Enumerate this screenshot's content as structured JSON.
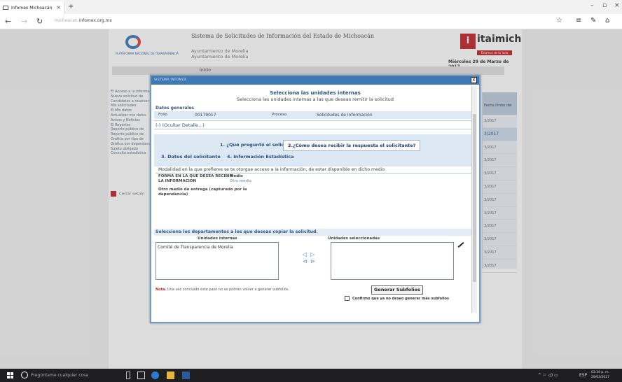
{
  "browser": {
    "tab_title": "Infomex Michoacán",
    "tab_close": "×",
    "new_tab": "+",
    "nav": {
      "back": "←",
      "forward": "→",
      "refresh": "↻"
    },
    "url_prefix": "michoacan.",
    "url": "infomex.org.mx",
    "window": {
      "minimize": "–",
      "restore": "▫",
      "close": "×"
    },
    "tools": {
      "favorite": "☆",
      "hub": "≡",
      "notes": "✎",
      "share": "⌂"
    }
  },
  "site": {
    "logo_caption": "PLATAFORMA NACIONAL DE TRANSPARENCIA",
    "title": "Sistema de Solicitudes de Información del Estado de Michoacán",
    "sub1": "Ayuntamiento de Morelia",
    "sub2": "Ayuntamiento de Morelia",
    "brand": "itaimich",
    "brand_mark": "i",
    "brand_pill": "Estamos de tu lado",
    "date": "Miércoles 29 de Marzo de 2017",
    "menu_home": "Inicio",
    "sidebar": [
      "El Acceso a la información",
      "Nueva solicitud de",
      "Candidatos a resolver",
      "Mis solicitudes",
      "El Mis datos",
      "Actualizar mis datos",
      "Avisos y Noticias",
      "El Reportes",
      "Reporte público de",
      "Reporte público de",
      "Gráfica por tipo de",
      "Gráfica por dependencia",
      "Sujeto obligado",
      "Consulta estadística"
    ],
    "logout": "Cerrar sesión",
    "right_header": "Fecha límite del",
    "right_dates": [
      "3/2017",
      "3/2017",
      "3/2017",
      "3/2017",
      "3/2017",
      "3/2017",
      "3/2017",
      "3/2017",
      "3/2017",
      "3/2017",
      "3/2017",
      "3/2017"
    ]
  },
  "modal": {
    "header": "SISTEMA INFOMEX",
    "close": "x",
    "heading": "Selecciona las unidades internas",
    "subheading": "Selecciona las unidades internas a las que deseas remitir la solicitud",
    "general_label": "Datos generales",
    "folio_label": "Folio",
    "folio_value": "00179017",
    "process_label": "Proceso",
    "process_value": "Solicitudes de Información",
    "toggle_details": "(-) (Ocultar Detalle...)",
    "tabs": {
      "t1": "1. ¿Qué preguntó el solicitante?",
      "t2": "2.¿Cómo desea recibir la respuesta el solicitante?",
      "t3": "3. Datos del solicitante",
      "t4": "4. Información Estadística"
    },
    "modality_text": "Modalidad en la que prefieres se te otorgue acceso a la información, de estar disponible en dicho medio",
    "form_label": "FORMA EN LA QUE DESEA RECIBIR LA INFORMACION",
    "medio_label": "Medio",
    "medio_value": "Otro medio",
    "other_label": "Otro medio de entrega (capturado por la dependencia)",
    "copy_section": "Selecciona los departamentos a los que deseas copiar la solicitud.",
    "internal_label": "Unidades internas",
    "selected_label": "Unidades seleccionadas",
    "internal_units": [
      "Comité de Transparencia de Morelia"
    ],
    "arrows": {
      "add": "▷",
      "remove": "◁",
      "add_all": "⊳",
      "remove_all": "⊲"
    },
    "note_prefix": "Nota.",
    "note_text": " Una vez concluido este paso no se podrán volver a generar subfolios.",
    "generate_button": "Generar Subfolios",
    "confirm_label": "Confirmo que ya no deseo generar más subfolios"
  },
  "taskbar": {
    "search_placeholder": "Pregúntame cualquier cosa",
    "language": "ESP",
    "time": "03:39 p. m.",
    "date": "29/03/2017",
    "tray_icons": "^  ⚐  ◁)  ▭"
  }
}
